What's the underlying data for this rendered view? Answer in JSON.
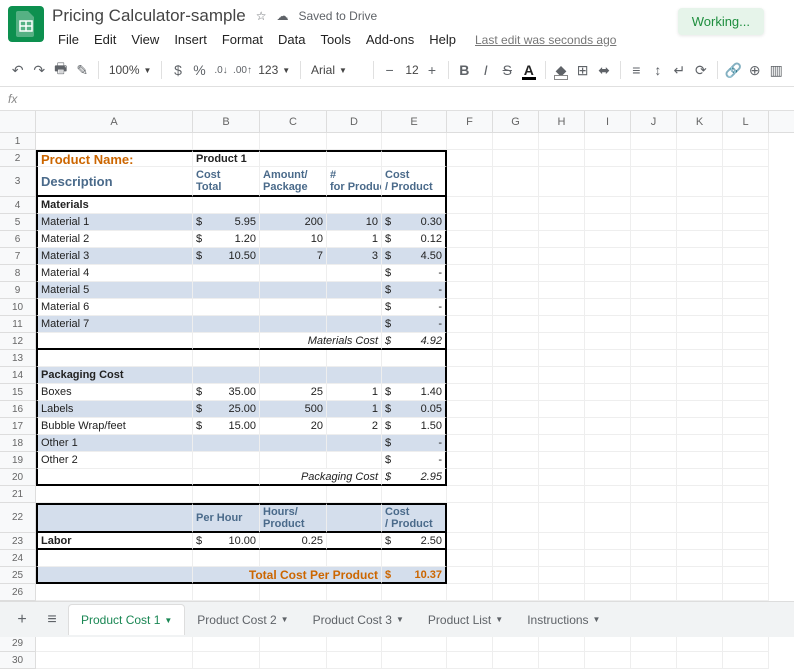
{
  "header": {
    "doc_title": "Pricing Calculator-sample",
    "saved_text": "Saved to Drive",
    "working": "Working...",
    "last_edit": "Last edit was seconds ago",
    "menus": [
      "File",
      "Edit",
      "View",
      "Insert",
      "Format",
      "Data",
      "Tools",
      "Add-ons",
      "Help"
    ]
  },
  "toolbar": {
    "zoom": "100%",
    "currency": "$",
    "percent": "%",
    "dec_dec": ".0",
    "dec_inc": ".00",
    "more_formats": "123",
    "font": "Arial",
    "font_size": "12"
  },
  "columns": [
    "A",
    "B",
    "C",
    "D",
    "E",
    "F",
    "G",
    "H",
    "I",
    "J",
    "K",
    "L"
  ],
  "rows_shown": 30,
  "sheet": {
    "product_name_label": "Product Name:",
    "product_name_value": "Product 1",
    "headers": {
      "description": "Description",
      "cost_total": "Cost Total",
      "amount_pkg": "Amount/ Package",
      "for_product": "# for Product",
      "cost_product": "Cost / Product"
    },
    "materials_section": "Materials",
    "materials": [
      {
        "name": "Material 1",
        "cost": "5.95",
        "amt": "200",
        "for": "10",
        "cp": "0.30"
      },
      {
        "name": "Material 2",
        "cost": "1.20",
        "amt": "10",
        "for": "1",
        "cp": "0.12"
      },
      {
        "name": "Material 3",
        "cost": "10.50",
        "amt": "7",
        "for": "3",
        "cp": "4.50"
      },
      {
        "name": "Material 4",
        "cost": "",
        "amt": "",
        "for": "",
        "cp": "-"
      },
      {
        "name": "Material 5",
        "cost": "",
        "amt": "",
        "for": "",
        "cp": "-"
      },
      {
        "name": "Material 6",
        "cost": "",
        "amt": "",
        "for": "",
        "cp": "-"
      },
      {
        "name": "Material 7",
        "cost": "",
        "amt": "",
        "for": "",
        "cp": "-"
      }
    ],
    "materials_cost_label": "Materials Cost",
    "materials_cost_value": "4.92",
    "packaging_section": "Packaging Cost",
    "packaging": [
      {
        "name": "Boxes",
        "cost": "35.00",
        "amt": "25",
        "for": "1",
        "cp": "1.40"
      },
      {
        "name": "Labels",
        "cost": "25.00",
        "amt": "500",
        "for": "1",
        "cp": "0.05"
      },
      {
        "name": "Bubble Wrap/feet",
        "cost": "15.00",
        "amt": "20",
        "for": "2",
        "cp": "1.50"
      },
      {
        "name": "Other 1",
        "cost": "",
        "amt": "",
        "for": "",
        "cp": "-"
      },
      {
        "name": "Other 2",
        "cost": "",
        "amt": "",
        "for": "",
        "cp": "-"
      }
    ],
    "packaging_cost_label": "Packaging Cost",
    "packaging_cost_value": "2.95",
    "labor_headers": {
      "per_hour": "Per Hour",
      "hours_product": "Hours/ Product",
      "cost_product": "Cost / Product"
    },
    "labor_label": "Labor",
    "labor": {
      "per_hour": "10.00",
      "hours": "0.25",
      "cp": "2.50"
    },
    "total_label": "Total Cost Per Product",
    "total_value": "10.37"
  },
  "tabs": [
    "Product Cost 1",
    "Product Cost 2",
    "Product Cost 3",
    "Product List",
    "Instructions"
  ]
}
